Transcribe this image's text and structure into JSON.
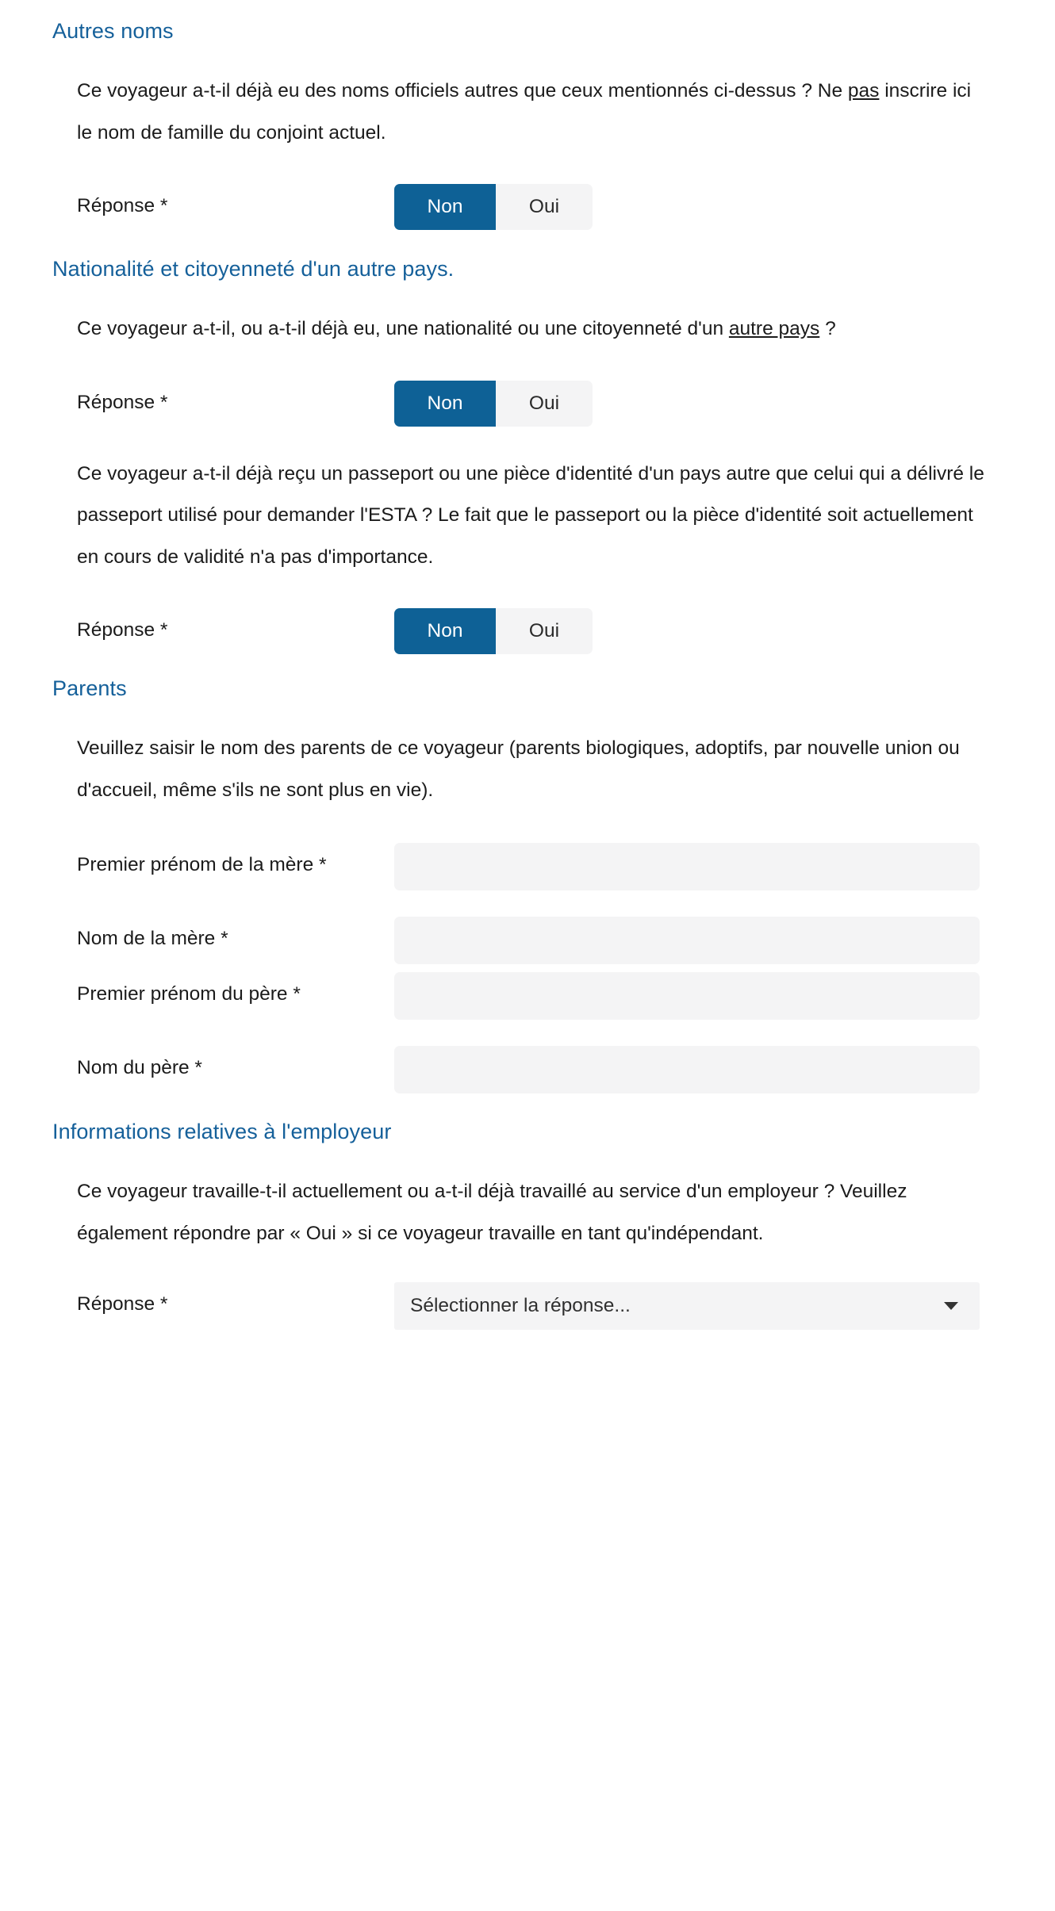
{
  "sections": [
    {
      "heading": "Autres noms",
      "paragraph": {
        "before": "Ce voyageur a-t-il déjà eu des noms officiels autres que ceux mentionnés ci-dessus ? Ne ",
        "underlined": "pas",
        "after": " inscrire ici le nom de famille du conjoint actuel."
      },
      "answer_label": "Réponse *",
      "toggle": {
        "no": "Non",
        "yes": "Oui",
        "selected": "Non"
      }
    },
    {
      "heading": "Nationalité et citoyenneté d'un autre pays.",
      "paragraph": {
        "before": "Ce voyageur a-t-il, ou a-t-il déjà eu, une nationalité ou une citoyenneté d'un ",
        "underlined": "autre pays",
        "after": " ?"
      },
      "answer_label": "Réponse *",
      "toggle": {
        "no": "Non",
        "yes": "Oui",
        "selected": "Non"
      },
      "paragraph2": "Ce voyageur a-t-il déjà reçu un passeport ou une pièce d'identité d'un pays autre que celui qui a délivré le passeport utilisé pour demander l'ESTA ? Le fait que le passeport ou la pièce d'identité soit actuellement en cours de validité n'a pas d'importance.",
      "answer_label2": "Réponse *",
      "toggle2": {
        "no": "Non",
        "yes": "Oui",
        "selected": "Non"
      }
    },
    {
      "heading": "Parents",
      "paragraph": "Veuillez saisir le nom des parents de ce voyageur (parents biologiques, adoptifs, par nouvelle union ou d'accueil, même s'ils ne sont plus en vie).",
      "fields": [
        {
          "label": "Premier prénom de la mère *",
          "value": "",
          "placeholder": ""
        },
        {
          "label": "Nom de la mère *",
          "value": "",
          "placeholder": ""
        },
        {
          "label": "Premier prénom du père *",
          "value": "",
          "placeholder": ""
        },
        {
          "label": "Nom du père *",
          "value": "",
          "placeholder": ""
        }
      ]
    },
    {
      "heading": "Informations relatives à l'employeur",
      "paragraph": "Ce voyageur travaille-t-il actuellement ou a-t-il déjà travaillé au service d'un employeur ? Veuillez également répondre par « Oui » si ce voyageur travaille en tant qu'indépendant.",
      "answer_label": "Réponse *",
      "select": {
        "selected": "Sélectionner la réponse...",
        "caret_icon": "chevron-down-icon"
      }
    }
  ],
  "colors": {
    "heading_blue": "#15609a",
    "toggle_active": "#0e6196",
    "field_bg": "#f4f4f5",
    "body_text": "#1b1b1b"
  }
}
